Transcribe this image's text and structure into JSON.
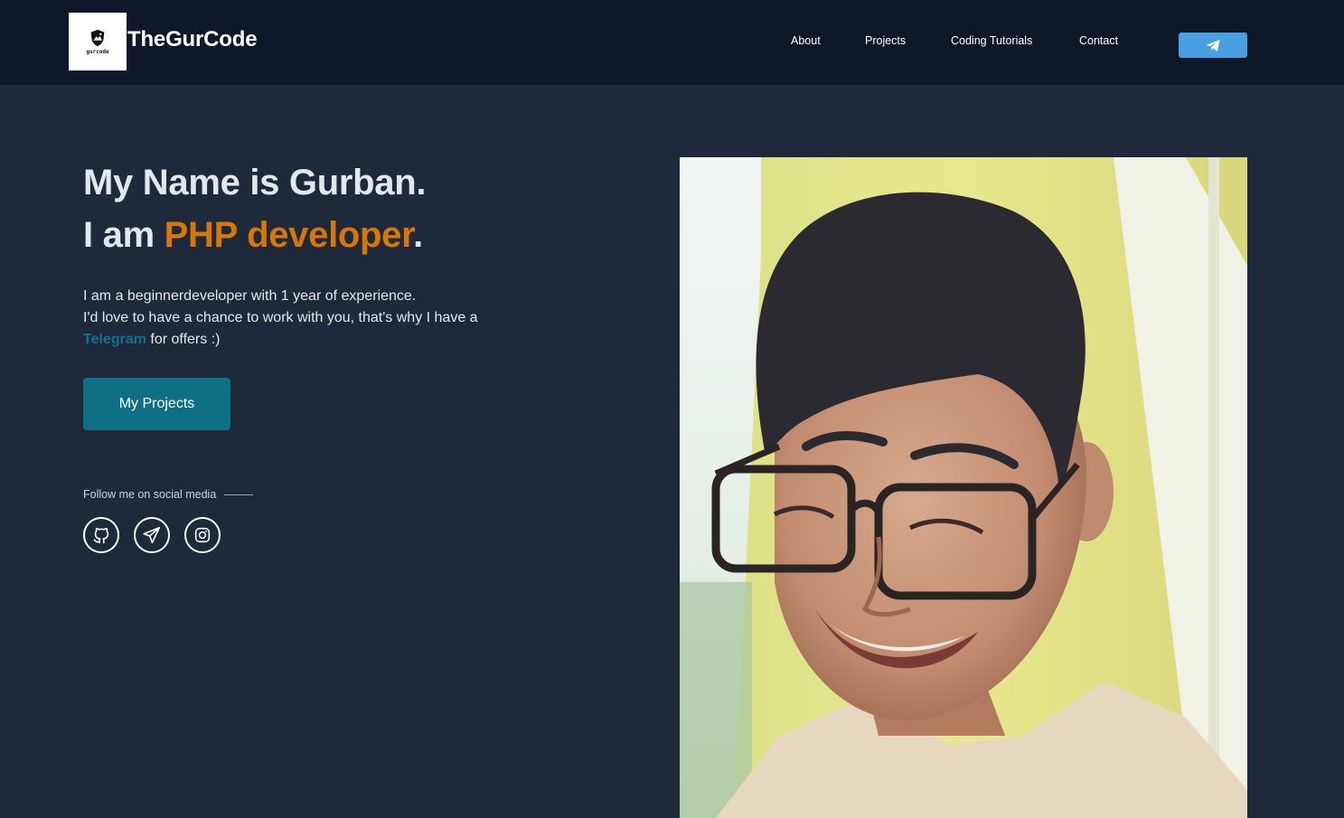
{
  "header": {
    "logo_caption": "gurcode",
    "brand": "TheGurCode",
    "nav": [
      {
        "label": "About"
      },
      {
        "label": "Projects"
      },
      {
        "label": "Coding Tutorials"
      },
      {
        "label": "Contact"
      }
    ],
    "telegram_icon": "telegram-icon"
  },
  "hero": {
    "line1": "My Name is Gurban.",
    "line2_prefix": "I am ",
    "line2_accent": "PHP developer",
    "line2_suffix": ".",
    "desc_line1": "I am a beginnerdeveloper with 1 year of experience.",
    "desc_line2": "I'd love to have a chance to work with you, that's why I have a",
    "desc_link": "Telegram",
    "desc_tail": " for offers :)",
    "cta_label": "My Projects",
    "follow_label": "Follow me on social media",
    "socials": [
      "github-icon",
      "telegram-icon",
      "instagram-icon"
    ]
  },
  "colors": {
    "page_bg": "#1e293b",
    "header_bg": "#0f172a",
    "accent": "#d97706",
    "link": "#0e7490",
    "cta_bg": "#0e6f85",
    "telegram_btn": "#4a9fe0"
  }
}
